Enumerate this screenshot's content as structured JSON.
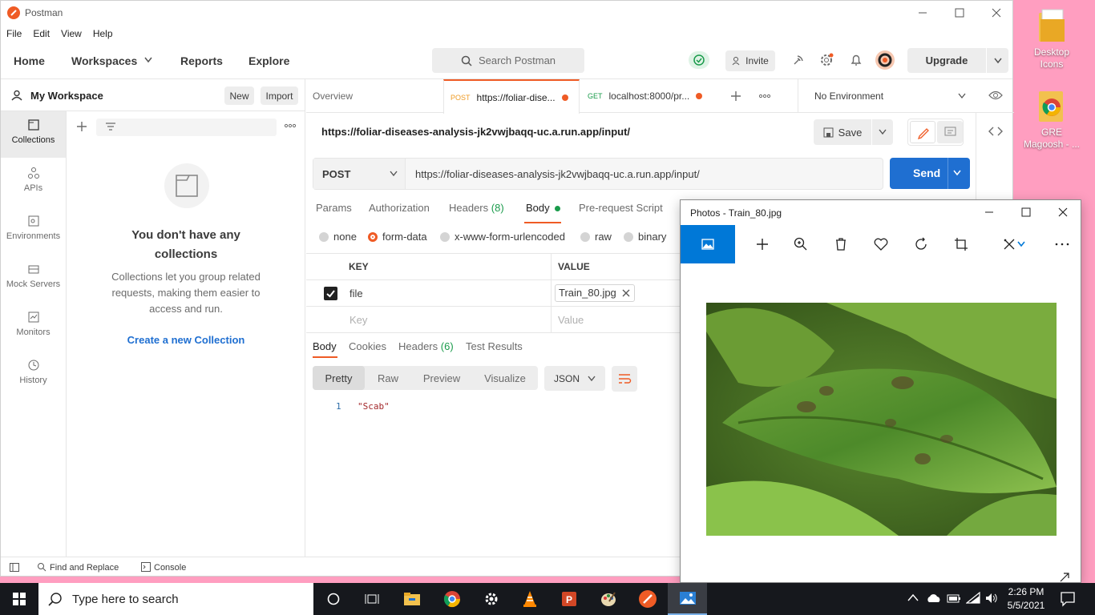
{
  "desktop": {
    "icons": [
      {
        "label_line1": "Desktop",
        "label_line2": "Icons"
      },
      {
        "label_line1": "GRE",
        "label_line2": "Magoosh - ..."
      }
    ]
  },
  "postman": {
    "window_title": "Postman",
    "menu": [
      "File",
      "Edit",
      "View",
      "Help"
    ],
    "nav": {
      "home": "Home",
      "workspaces": "Workspaces",
      "reports": "Reports",
      "explore": "Explore"
    },
    "search_placeholder": "Search Postman",
    "invite": "Invite",
    "upgrade": "Upgrade",
    "workspace": {
      "name": "My Workspace",
      "new": "New",
      "import": "Import"
    },
    "rail": [
      "Collections",
      "APIs",
      "Environments",
      "Mock Servers",
      "Monitors",
      "History"
    ],
    "empty": {
      "title_line1": "You don't have any",
      "title_line2": "collections",
      "desc_line1": "Collections let you group related",
      "desc_line2": "requests, making them easier to",
      "desc_line3": "access and run.",
      "link": "Create a new Collection"
    },
    "tabs": [
      {
        "label": "Overview"
      },
      {
        "method": "POST",
        "label": "https://foliar-dise..."
      },
      {
        "method": "GET",
        "label": "localhost:8000/pr..."
      }
    ],
    "environment": "No Environment",
    "request": {
      "title": "https://foliar-diseases-analysis-jk2vwjbaqq-uc.a.run.app/input/",
      "save": "Save",
      "method": "POST",
      "url": "https://foliar-diseases-analysis-jk2vwjbaqq-uc.a.run.app/input/",
      "send": "Send",
      "subtabs": {
        "params": "Params",
        "auth": "Authorization",
        "headers": "Headers",
        "headers_count": "(8)",
        "body": "Body",
        "prerequest": "Pre-request Script"
      },
      "body_types": [
        "none",
        "form-data",
        "x-www-form-urlencoded",
        "raw",
        "binary"
      ],
      "table": {
        "key_header": "KEY",
        "value_header": "VALUE",
        "row_key": "file",
        "row_value": "Train_80.jpg",
        "key_placeholder": "Key",
        "value_placeholder": "Value"
      }
    },
    "response": {
      "tabs": {
        "body": "Body",
        "cookies": "Cookies",
        "headers": "Headers",
        "headers_count": "(6)",
        "tests": "Test Results"
      },
      "views": [
        "Pretty",
        "Raw",
        "Preview",
        "Visualize"
      ],
      "format": "JSON",
      "line_number": "1",
      "line_text": "\"Scab\""
    },
    "footer": {
      "find": "Find and Replace",
      "console": "Console"
    }
  },
  "photos": {
    "title": "Photos - Train_80.jpg"
  },
  "taskbar": {
    "search_placeholder": "Type here to search",
    "time": "2:26 PM",
    "date": "5/5/2021"
  },
  "colors": {
    "accent": "#ef5b25",
    "send": "#1f6fd1",
    "link": "#1f6fd1",
    "photos_blue": "#0078d7"
  }
}
